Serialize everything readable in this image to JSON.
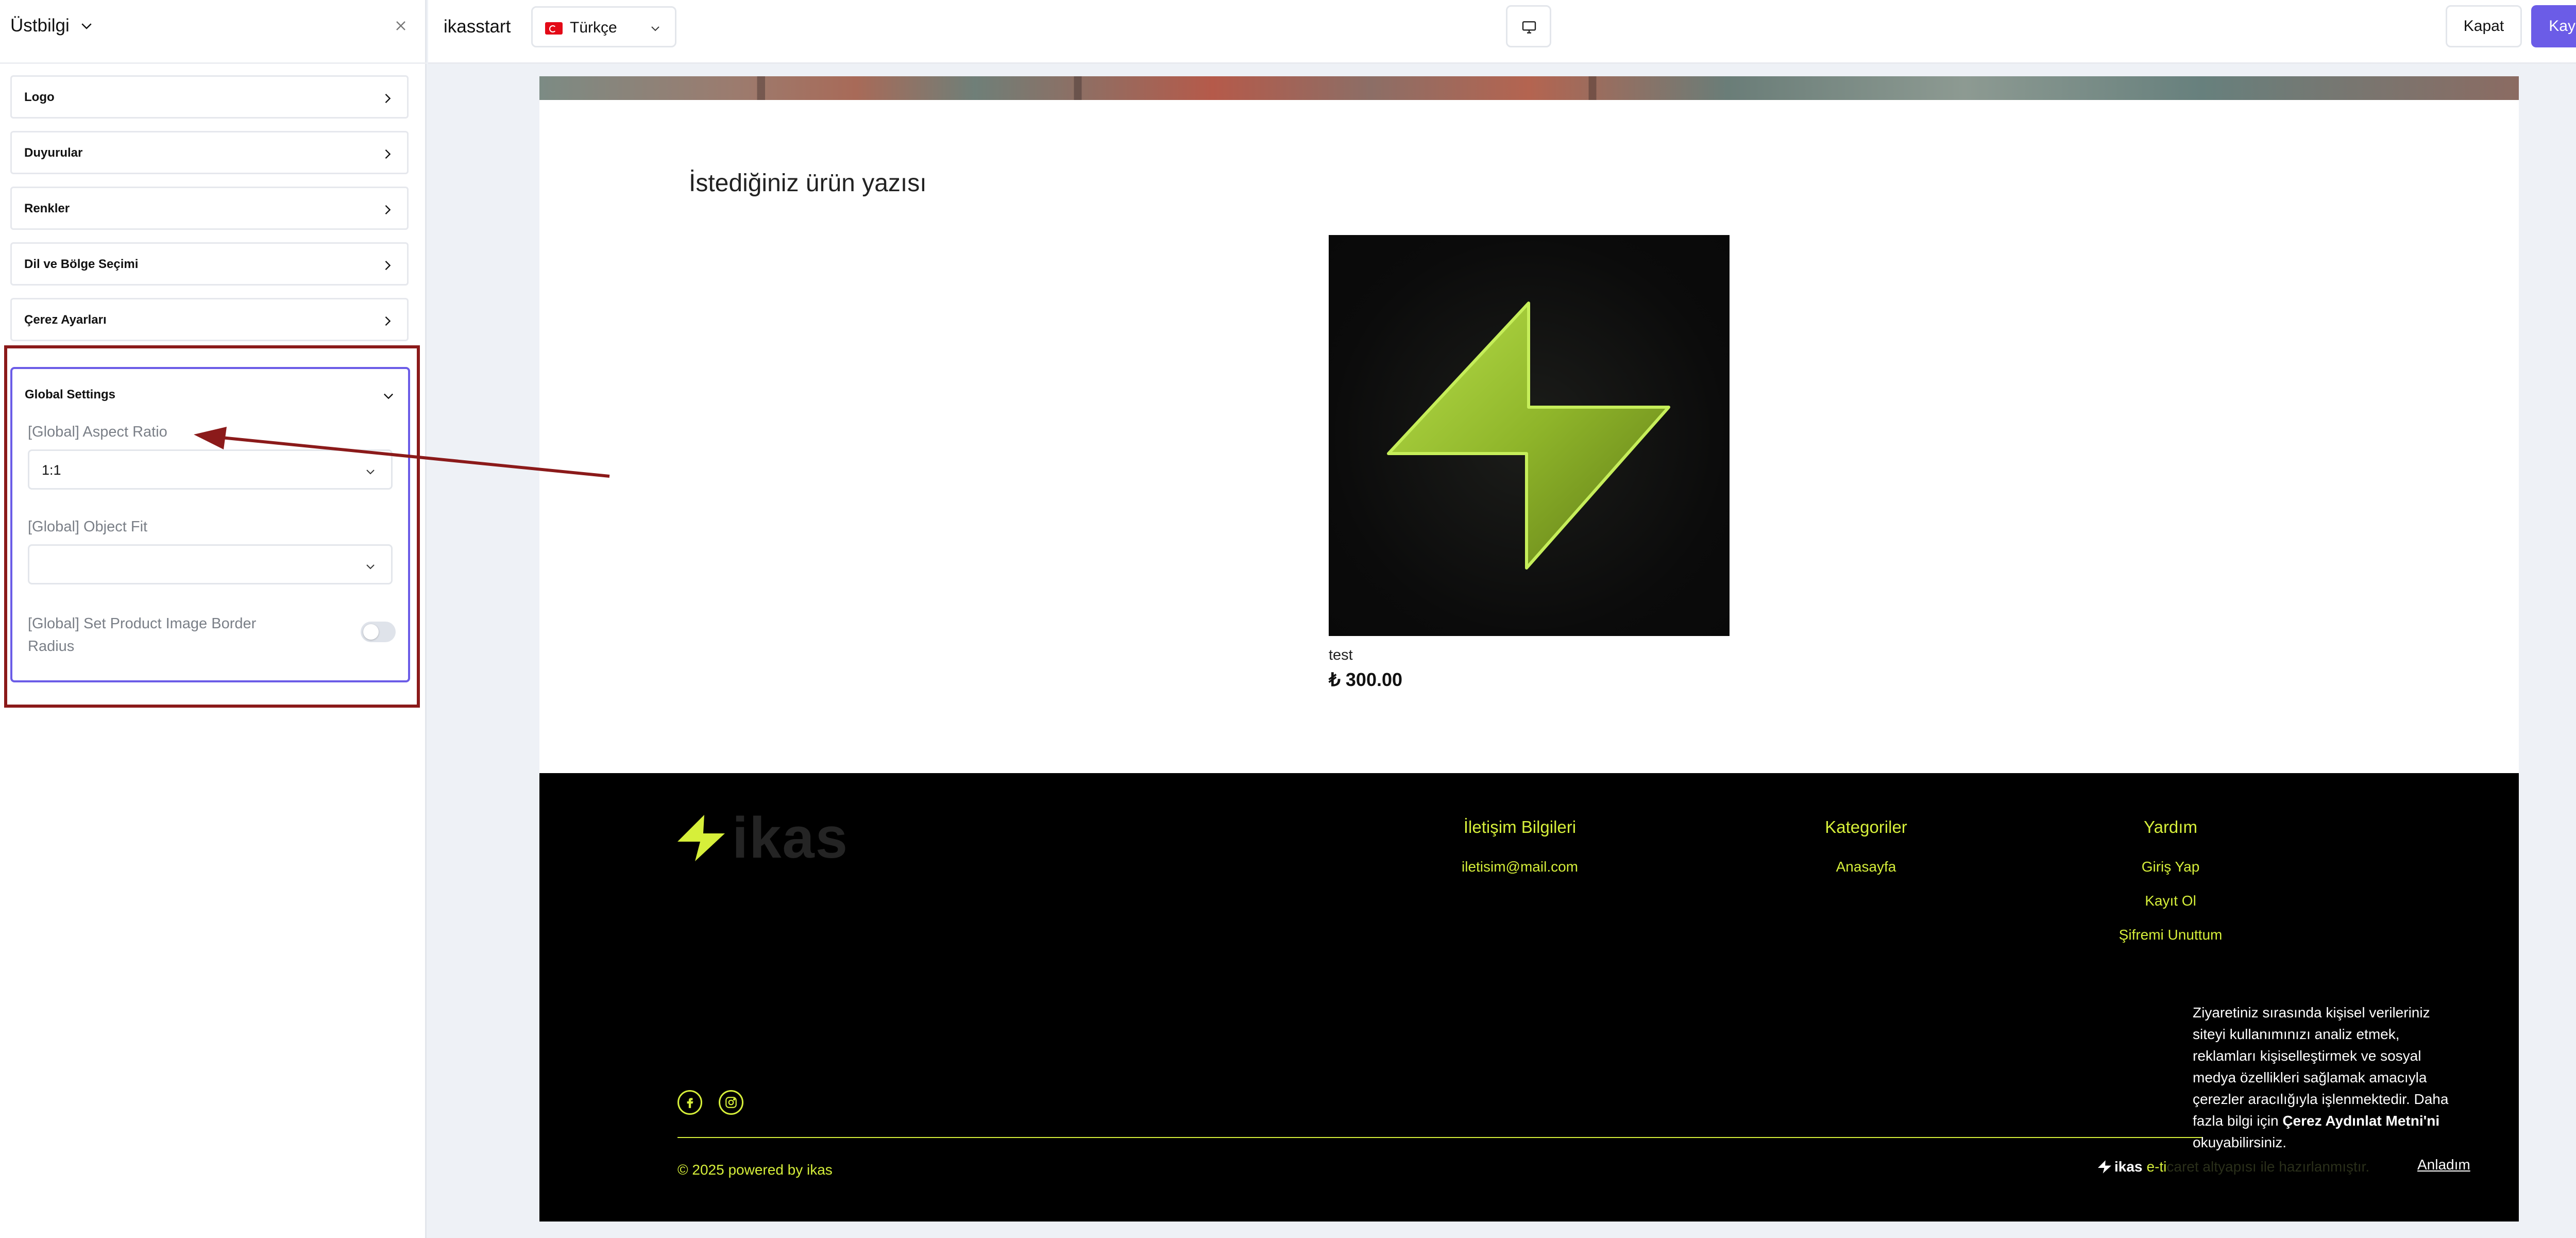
{
  "panel": {
    "title": "Üstbilgi",
    "sections": [
      {
        "label": "Logo"
      },
      {
        "label": "Duyurular"
      },
      {
        "label": "Renkler"
      },
      {
        "label": "Dil ve Bölge Seçimi"
      },
      {
        "label": "Çerez Ayarları"
      }
    ],
    "global_settings": {
      "title": "Global Settings",
      "aspect_ratio_label": "[Global] Aspect Ratio",
      "aspect_ratio_value": "1:1",
      "object_fit_label": "[Global] Object Fit",
      "object_fit_value": "",
      "border_radius_label_line1": "[Global] Set Product Image Border",
      "border_radius_label_line2": "Radius",
      "border_radius_enabled": false
    }
  },
  "topbar": {
    "store_name": "ikasstart",
    "language": "Türkçe",
    "close_label": "Kapat",
    "save_label": "Kaydet"
  },
  "preview": {
    "heading": "İstediğiniz ürün yazısı",
    "product": {
      "name": "test",
      "price": "₺ 300.00"
    },
    "footer": {
      "logo_text": "ikas",
      "contact_title": "İletişim Bilgileri",
      "contact_email": "iletisim@mail.com",
      "categories_title": "Kategoriler",
      "categories": [
        "Anasayfa"
      ],
      "help_title": "Yardım",
      "help_links": [
        "Giriş Yap",
        "Kayıt Ol",
        "Şifremi Unuttum"
      ],
      "copyright": "© 2025 powered by ikas",
      "badge_brand": "ikas",
      "badge_visible": "e-ti",
      "badge_faded": "caret altyapısı ile hazırlanmıştır."
    },
    "cookie": {
      "text": "Ziyaretiniz sırasında kişisel verileriniz siteyi kullanımınızı analiz etmek, reklamları kişiselleştirmek ve sosyal medya özellikleri sağlamak amacıyla çerezler aracılığıyla işlenmektedir. Daha fazla bilgi için",
      "link": "Çerez Aydınlat Metni'ni",
      "suffix": "okuyabilirsiniz.",
      "accept": "Anladım"
    }
  },
  "colors": {
    "accent": "#6b5ce7",
    "footer_accent": "#d6ef3a",
    "annotation": "#8b1a1a"
  },
  "icons": {
    "panel_title": "chevron-down-icon",
    "close": "close-icon",
    "section": "chevron-right-icon",
    "device": "desktop-icon",
    "social": [
      "facebook-icon",
      "instagram-icon"
    ]
  }
}
